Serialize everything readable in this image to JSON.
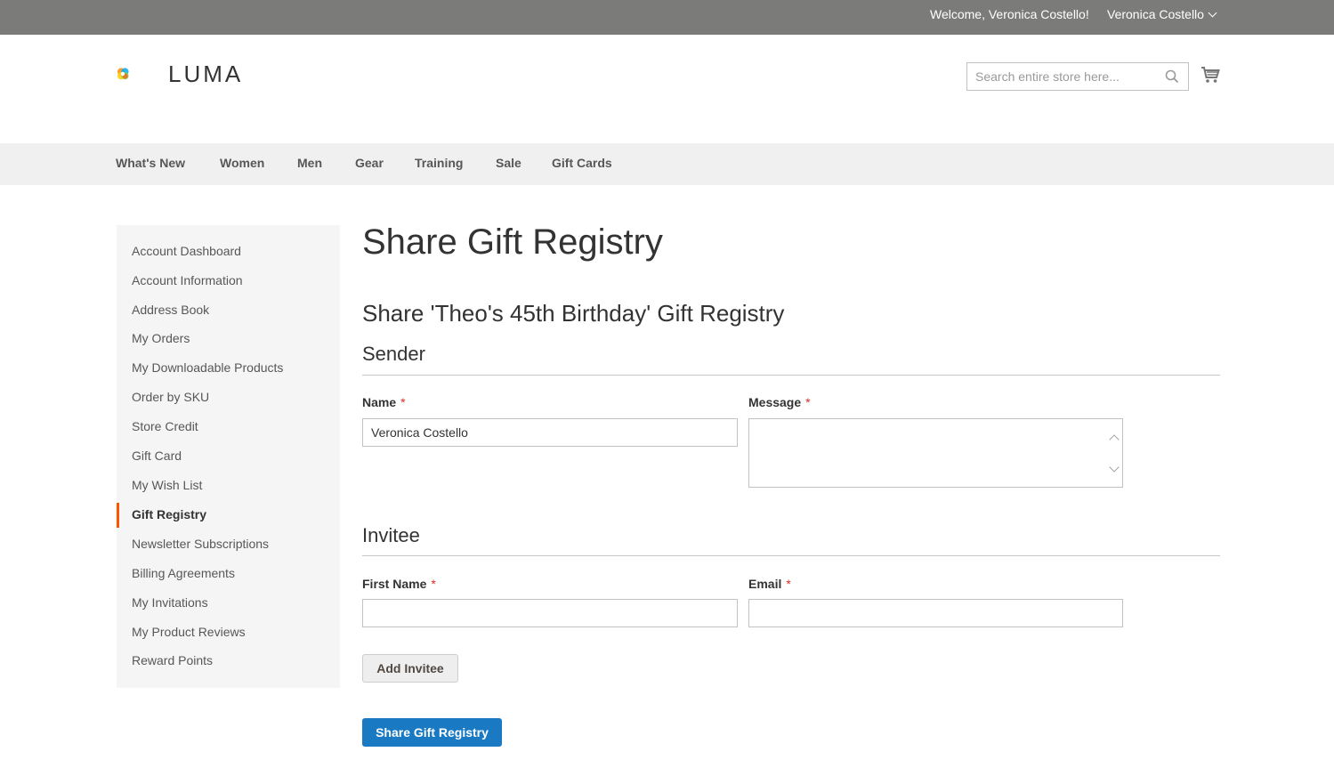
{
  "header": {
    "welcome": "Welcome, Veronica Costello!",
    "customer_name": "Veronica Costello",
    "logo_text": "LUMA",
    "search_placeholder": "Search entire store here..."
  },
  "nav": {
    "items": [
      "What's New",
      "Women",
      "Men",
      "Gear",
      "Training",
      "Sale",
      "Gift Cards"
    ]
  },
  "sidebar": {
    "items": [
      "Account Dashboard",
      "Account Information",
      "Address Book",
      "My Orders",
      "My Downloadable Products",
      "Order by SKU",
      "Store Credit",
      "Gift Card",
      "My Wish List",
      "Gift Registry",
      "Newsletter Subscriptions",
      "Billing Agreements",
      "My Invitations",
      "My Product Reviews",
      "Reward Points"
    ],
    "active": "Gift Registry"
  },
  "main": {
    "page_title": "Share Gift Registry",
    "sub_title": "Share 'Theo's 45th Birthday' Gift Registry",
    "sender": {
      "legend": "Sender",
      "name_label": "Name",
      "name_value": "Veronica Costello",
      "message_label": "Message",
      "message_value": ""
    },
    "invitee": {
      "legend": "Invitee",
      "first_name_label": "First Name",
      "first_name_value": "",
      "email_label": "Email",
      "email_value": ""
    },
    "required_mark": "*",
    "add_invitee_button": "Add Invitee",
    "share_button": "Share Gift Registry"
  },
  "colors": {
    "top_bar": "#7b7c7a",
    "nav_bg": "#f0f0f0",
    "sidebar_bg": "#f5f5f5",
    "active_marker": "#ff5501",
    "primary_button": "#1979c3",
    "required": "#e02b27"
  }
}
